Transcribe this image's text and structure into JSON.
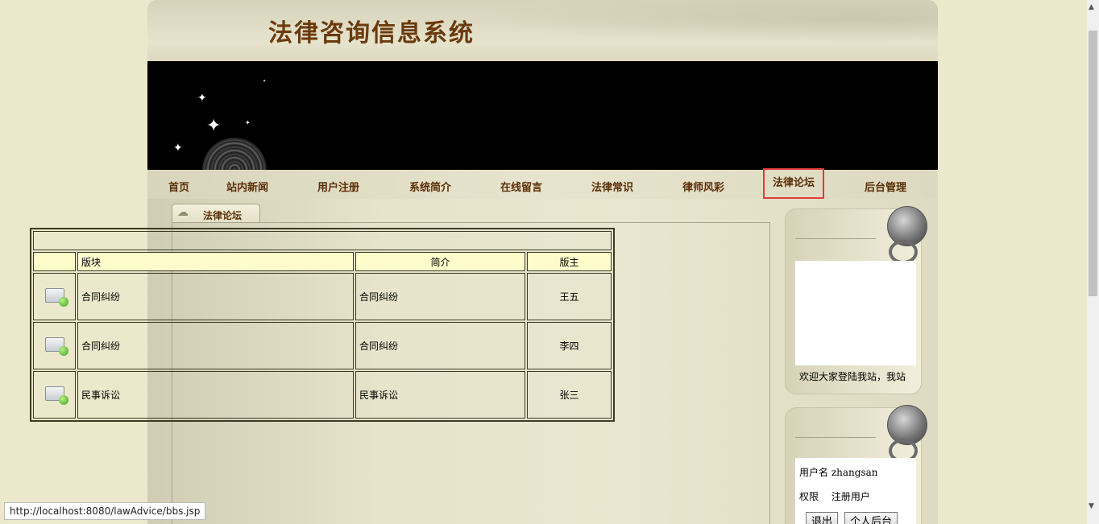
{
  "site": {
    "title": "法律咨询信息系统"
  },
  "nav": [
    {
      "label": "首页"
    },
    {
      "label": "站内新闻"
    },
    {
      "label": "用户注册"
    },
    {
      "label": "系统简介"
    },
    {
      "label": "在线留言"
    },
    {
      "label": "法律常识"
    },
    {
      "label": "律师风彩"
    },
    {
      "label": "法律论坛"
    },
    {
      "label": "后台管理"
    }
  ],
  "forum": {
    "tab_label": "法律论坛",
    "headers": [
      "",
      "版块",
      "简介",
      "版主"
    ],
    "rows": [
      {
        "board": "合同纠纷",
        "desc": "合同纠纷",
        "moderator": "王五"
      },
      {
        "board": "合同纠纷",
        "desc": "合同纠纷",
        "moderator": "李四"
      },
      {
        "board": "民事诉讼",
        "desc": "民事诉讼",
        "moderator": "张三"
      }
    ]
  },
  "sidebar": {
    "welcome": "欢迎大家登陆我站，我站",
    "username_label": "用户名",
    "username": "zhangsan",
    "role_label": "权限",
    "role": "注册用户",
    "logout_label": "退出",
    "personal_label": "个人后台"
  },
  "status": {
    "url": "http://localhost:8080/lawAdvice/bbs.jsp"
  }
}
